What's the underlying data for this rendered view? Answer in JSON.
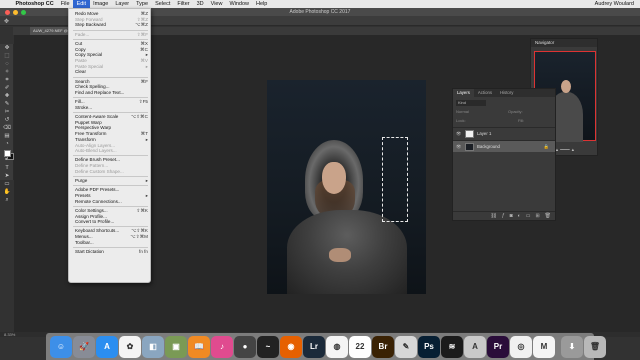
{
  "menubar": {
    "apple": "",
    "items": [
      {
        "label": "Photoshop CC",
        "bold": true
      },
      {
        "label": "File"
      },
      {
        "label": "Edit",
        "active": true
      },
      {
        "label": "Image"
      },
      {
        "label": "Layer"
      },
      {
        "label": "Type"
      },
      {
        "label": "Select"
      },
      {
        "label": "Filter"
      },
      {
        "label": "3D"
      },
      {
        "label": "View"
      },
      {
        "label": "Window"
      },
      {
        "label": "Help"
      }
    ],
    "user": "Audrey Woulard"
  },
  "window": {
    "title": "Adobe Photoshop CC 2017"
  },
  "document": {
    "tab": "AUW_4279.NEF @"
  },
  "status": {
    "zoom": "8.33%"
  },
  "edit_menu": [
    {
      "label": "Redo Move",
      "shortcut": "⌘Z"
    },
    {
      "label": "Step Forward",
      "shortcut": "⇧⌘Z",
      "disabled": true
    },
    {
      "label": "Step Backward",
      "shortcut": "⌥⌘Z"
    },
    {
      "sep": true
    },
    {
      "label": "Fade...",
      "shortcut": "⇧⌘F",
      "disabled": true
    },
    {
      "sep": true
    },
    {
      "label": "Cut",
      "shortcut": "⌘X"
    },
    {
      "label": "Copy",
      "shortcut": "⌘C"
    },
    {
      "label": "Copy Special",
      "shortcut": "▸"
    },
    {
      "label": "Paste",
      "shortcut": "⌘V",
      "disabled": true
    },
    {
      "label": "Paste Special",
      "shortcut": "▸",
      "disabled": true
    },
    {
      "label": "Clear"
    },
    {
      "sep": true
    },
    {
      "label": "Search",
      "shortcut": "⌘F"
    },
    {
      "label": "Check Spelling..."
    },
    {
      "label": "Find and Replace Text..."
    },
    {
      "sep": true
    },
    {
      "label": "Fill...",
      "shortcut": "⇧F5"
    },
    {
      "label": "Stroke..."
    },
    {
      "sep": true
    },
    {
      "label": "Content-Aware Scale",
      "shortcut": "⌥⇧⌘C"
    },
    {
      "label": "Puppet Warp"
    },
    {
      "label": "Perspective Warp"
    },
    {
      "label": "Free Transform",
      "shortcut": "⌘T"
    },
    {
      "label": "Transform",
      "shortcut": "▸"
    },
    {
      "label": "Auto-Align Layers...",
      "disabled": true
    },
    {
      "label": "Auto-Blend Layers...",
      "disabled": true
    },
    {
      "sep": true
    },
    {
      "label": "Define Brush Preset..."
    },
    {
      "label": "Define Pattern...",
      "disabled": true
    },
    {
      "label": "Define Custom Shape...",
      "disabled": true
    },
    {
      "sep": true
    },
    {
      "label": "Purge",
      "shortcut": "▸"
    },
    {
      "sep": true
    },
    {
      "label": "Adobe PDF Presets..."
    },
    {
      "label": "Presets",
      "shortcut": "▸"
    },
    {
      "label": "Remote Connections..."
    },
    {
      "sep": true
    },
    {
      "label": "Color Settings...",
      "shortcut": "⇧⌘K"
    },
    {
      "label": "Assign Profile..."
    },
    {
      "label": "Convert to Profile..."
    },
    {
      "sep": true
    },
    {
      "label": "Keyboard Shortcuts...",
      "shortcut": "⌥⇧⌘K"
    },
    {
      "label": "Menus...",
      "shortcut": "⌥⇧⌘M"
    },
    {
      "label": "Toolbar..."
    },
    {
      "sep": true
    },
    {
      "label": "Start Dictation",
      "shortcut": "fn fn"
    }
  ],
  "navigator": {
    "title": "Navigator"
  },
  "layers_panel": {
    "tabs": [
      "Layers",
      "Actions",
      "History"
    ],
    "filter": "Kind",
    "blend": "Normal",
    "opacity_label": "Opacity:",
    "lock_label": "Lock:",
    "fill_label": "Fill:",
    "layers": [
      {
        "name": "Layer 1",
        "thumb": "#f2f2f2",
        "selected": false
      },
      {
        "name": "Background",
        "thumb": "#1b1f25",
        "selected": true
      }
    ]
  },
  "toolbox": [
    "move-icon",
    "marquee-icon",
    "lasso-icon",
    "quick-select-icon",
    "crop-icon",
    "eyedropper-icon",
    "healing-icon",
    "brush-icon",
    "clone-stamp-icon",
    "history-brush-icon",
    "eraser-icon",
    "gradient-icon",
    "blur-icon",
    "dodge-icon",
    "pen-icon",
    "type-icon",
    "path-select-icon",
    "shape-icon",
    "hand-icon",
    "zoom-icon"
  ],
  "dock": [
    {
      "name": "finder",
      "bg": "#3d8fe8",
      "glyph": "☺"
    },
    {
      "name": "launchpad",
      "bg": "#888c96",
      "glyph": "🚀"
    },
    {
      "name": "app-store",
      "bg": "#2b8ef0",
      "glyph": "A"
    },
    {
      "name": "photos",
      "bg": "#f4f4f4",
      "glyph": "✿"
    },
    {
      "name": "preview",
      "bg": "#8aa6c0",
      "glyph": "◧"
    },
    {
      "name": "image-capture",
      "bg": "#7a9a55",
      "glyph": "▣"
    },
    {
      "name": "ibooks",
      "bg": "#f08a23",
      "glyph": "📖"
    },
    {
      "name": "itunes",
      "bg": "#e04b8f",
      "glyph": "♪"
    },
    {
      "name": "music",
      "bg": "#444",
      "glyph": "●"
    },
    {
      "name": "activity-monitor",
      "bg": "#222",
      "glyph": "~"
    },
    {
      "name": "firefox",
      "bg": "#e66000",
      "glyph": "◉"
    },
    {
      "name": "lightroom",
      "bg": "#1b2a3a",
      "glyph": "Lr"
    },
    {
      "name": "safari",
      "bg": "#f5f5f5",
      "glyph": "◍"
    },
    {
      "name": "calendar",
      "bg": "#ffffff",
      "glyph": "22"
    },
    {
      "name": "bridge",
      "bg": "#3a2204",
      "glyph": "Br"
    },
    {
      "name": "notes",
      "bg": "#d7d7d7",
      "glyph": "✎"
    },
    {
      "name": "photoshop",
      "bg": "#071f33",
      "glyph": "Ps"
    },
    {
      "name": "spotify",
      "bg": "#1b1b1b",
      "glyph": "≋"
    },
    {
      "name": "acrobat",
      "bg": "#c9c9c9",
      "glyph": "A"
    },
    {
      "name": "premiere",
      "bg": "#2a0d3a",
      "glyph": "Pr"
    },
    {
      "name": "chrome",
      "bg": "#f1f1f1",
      "glyph": "◎"
    },
    {
      "name": "word",
      "bg": "#f5f5f5",
      "glyph": "M"
    },
    {
      "name": "downloads",
      "bg": "#9a9a9a",
      "glyph": "⬇"
    },
    {
      "name": "trash",
      "bg": "#b8b8b8",
      "glyph": "🗑"
    }
  ]
}
